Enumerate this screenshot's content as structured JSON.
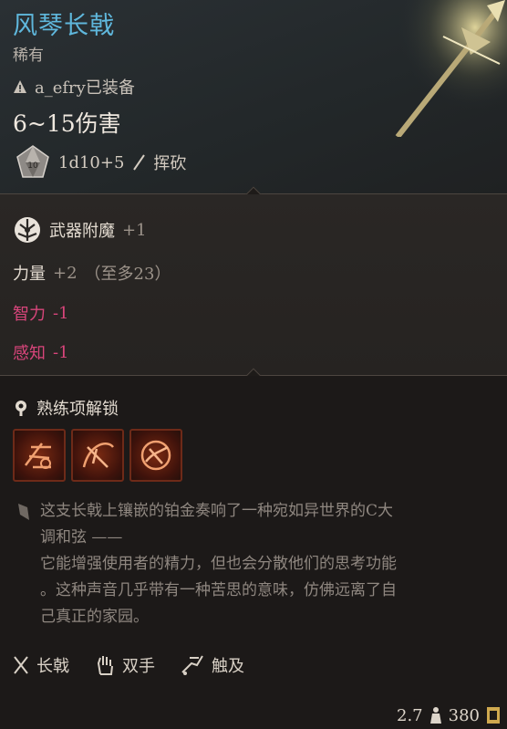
{
  "item": {
    "name": "风琴长戟",
    "rarity": "稀有",
    "equipped_by": "a_efry已装备",
    "damage": "6~15伤害",
    "dice": "1d10+5",
    "damage_type": "挥砍"
  },
  "enchant": {
    "label": "武器附魔",
    "value": "+1"
  },
  "stats": [
    {
      "name": "力量",
      "value": "+2",
      "note": "（至多23）"
    },
    {
      "name": "智力",
      "value": "-1"
    },
    {
      "name": "感知",
      "value": "-1"
    }
  ],
  "proficiency": {
    "label": "熟练项解锁",
    "skills": [
      "skill-icon-1",
      "skill-icon-2",
      "skill-icon-3"
    ]
  },
  "description": {
    "line1": "这支长戟上镶嵌的铂金奏响了一种宛如异世界的C大",
    "line2": "调和弦 ——",
    "line3": "它能增强使用者的精力，但也会分散他们的思考功能",
    "line4": "。这种声音几乎带有一种苦思的意味，仿佛远离了自",
    "line5": "己真正的家园。"
  },
  "tags": [
    "长戟",
    "双手",
    "触及"
  ],
  "footer": {
    "weight": "2.7",
    "value": "380"
  },
  "colors": {
    "title": "#5fb7dc",
    "negative": "#d8457b",
    "positive": "#9c938a"
  }
}
